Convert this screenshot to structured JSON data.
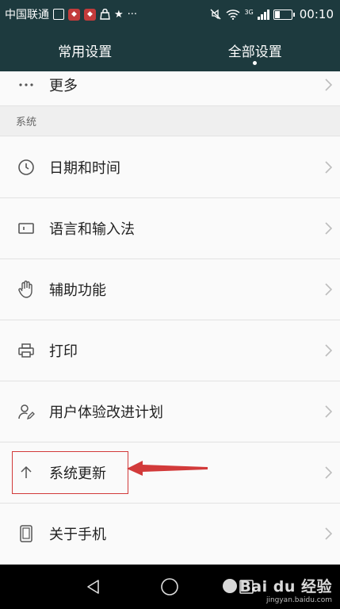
{
  "status_bar": {
    "carrier": "中国联通",
    "network": "3G",
    "time": "00:10",
    "battery_percent": 30
  },
  "tabs": [
    {
      "label": "常用设置",
      "active": false
    },
    {
      "label": "全部设置",
      "active": true
    }
  ],
  "rows": {
    "more": {
      "label": "更多",
      "icon": "ellipsis-icon"
    },
    "section_system": "系统",
    "date_time": {
      "label": "日期和时间",
      "icon": "clock-icon"
    },
    "language_input": {
      "label": "语言和输入法",
      "icon": "keyboard-icon"
    },
    "accessibility": {
      "label": "辅助功能",
      "icon": "hand-icon"
    },
    "print": {
      "label": "打印",
      "icon": "printer-icon"
    },
    "user_experience": {
      "label": "用户体验改进计划",
      "icon": "user-edit-icon"
    },
    "system_update": {
      "label": "系统更新",
      "icon": "arrow-up-icon"
    },
    "about_phone": {
      "label": "关于手机",
      "icon": "phone-icon"
    }
  },
  "watermark": {
    "brand": "Bai du 经验",
    "url": "jingyan.baidu.com"
  },
  "colors": {
    "header_bg": "#1d3a3e",
    "annotation_red": "#d23a3a",
    "chevron": "#bdbdbd"
  }
}
